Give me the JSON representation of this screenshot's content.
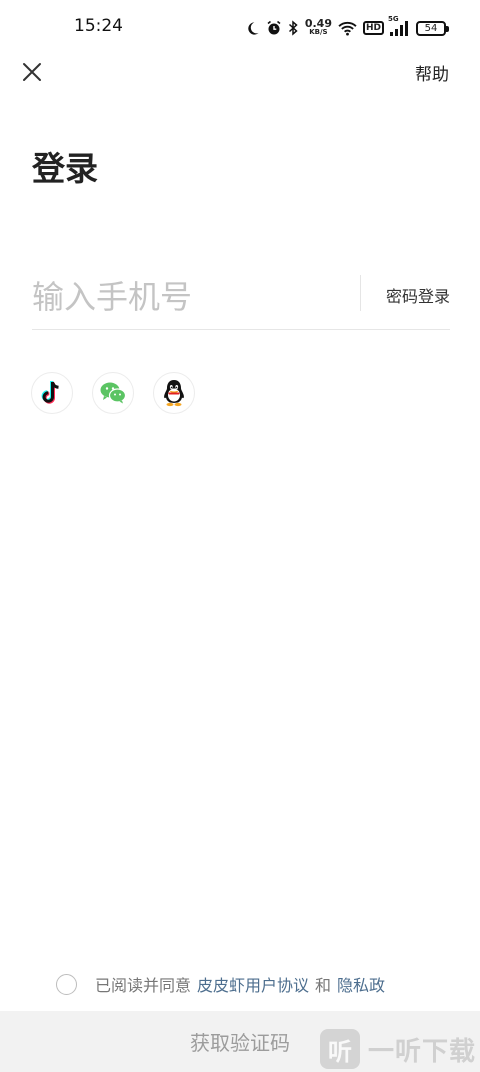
{
  "status_bar": {
    "time": "15:24",
    "net_speed_value": "0.49",
    "net_speed_unit": "KB/S",
    "hd_label": "HD",
    "signal_label": "5G",
    "battery": "54",
    "icons": [
      "moon-icon",
      "alarm-icon",
      "bluetooth-icon",
      "wifi-icon",
      "signal-icon",
      "battery-icon"
    ]
  },
  "nav": {
    "close_icon": "close-icon",
    "help_label": "帮助"
  },
  "title": "登录",
  "phone": {
    "placeholder": "输入手机号",
    "value": ""
  },
  "password_login_label": "密码登录",
  "social": {
    "items": [
      "tiktok-icon",
      "wechat-icon",
      "qq-icon"
    ],
    "colors": {
      "wechat": "#5bc463",
      "tiktok_cyan": "#25f4ee",
      "tiktok_red": "#fe2c55"
    }
  },
  "agreement": {
    "prefix": "已阅读并同意",
    "user_agreement": "皮皮虾用户协议",
    "and": "和",
    "privacy": "隐私政",
    "link_color": "#4d6e8e"
  },
  "get_code_label": "获取验证码",
  "watermark": {
    "icon_text": "听",
    "text": "一听下载"
  }
}
